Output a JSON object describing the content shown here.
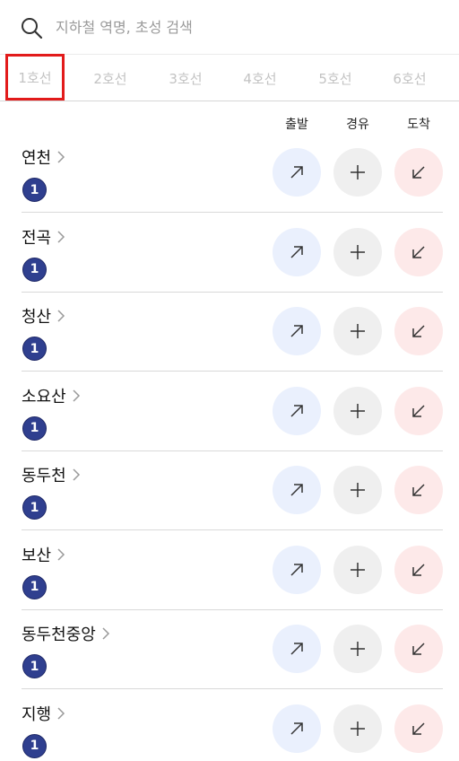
{
  "search": {
    "placeholder": "지하철 역명, 초성 검색"
  },
  "tabs": [
    {
      "label": "1호선",
      "selected": true
    },
    {
      "label": "2호선",
      "selected": false
    },
    {
      "label": "3호선",
      "selected": false
    },
    {
      "label": "4호선",
      "selected": false
    },
    {
      "label": "5호선",
      "selected": false
    },
    {
      "label": "6호선",
      "selected": false
    }
  ],
  "columns": {
    "depart": "출발",
    "via": "경유",
    "arrive": "도착"
  },
  "stations": [
    {
      "name": "연천",
      "line": "1"
    },
    {
      "name": "전곡",
      "line": "1"
    },
    {
      "name": "청산",
      "line": "1"
    },
    {
      "name": "소요산",
      "line": "1"
    },
    {
      "name": "동두천",
      "line": "1"
    },
    {
      "name": "보산",
      "line": "1"
    },
    {
      "name": "동두천중앙",
      "line": "1"
    },
    {
      "name": "지행",
      "line": "1"
    }
  ],
  "colors": {
    "line1": "#2f3f8f",
    "depart_bg": "#eaf0fd",
    "via_bg": "#efefef",
    "arrive_bg": "#fde9e9",
    "selection_highlight": "#e21b1b"
  },
  "icons": {
    "search": "search-icon",
    "chevron": "chevron-right-icon",
    "depart": "arrow-up-right-icon",
    "via": "plus-icon",
    "arrive": "arrow-down-left-icon"
  }
}
